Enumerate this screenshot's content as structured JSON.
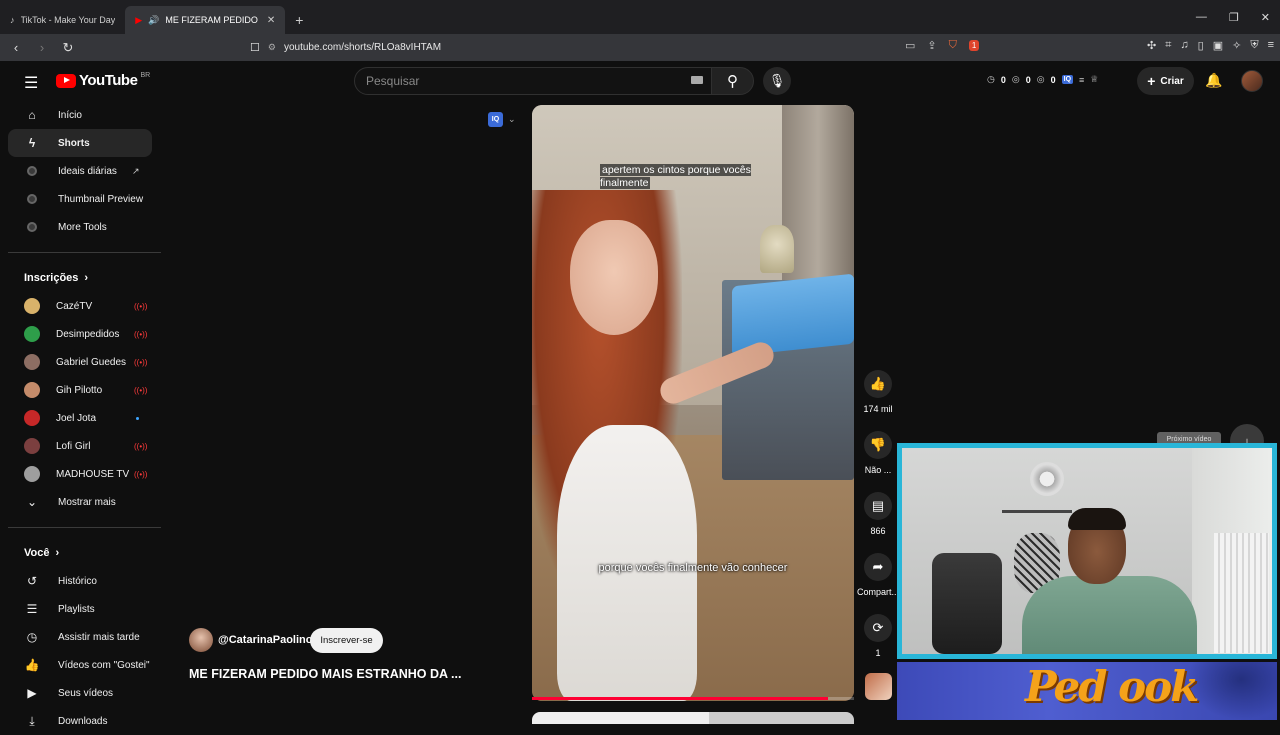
{
  "browser": {
    "tabs": [
      {
        "title": "TikTok - Make Your Day",
        "active": false
      },
      {
        "title": "ME FIZERAM PEDIDO MAIS E",
        "active": true
      }
    ],
    "url": "youtube.com/shorts/RLOa8vIHTAM",
    "brave_badge": "1"
  },
  "header": {
    "logo_text": "YouTube",
    "region": "BR",
    "search_placeholder": "Pesquisar",
    "stats": [
      "0",
      "0",
      "0"
    ],
    "iq_label": "IQ",
    "create_label": "Criar"
  },
  "sidebar": {
    "main": [
      {
        "label": "Início",
        "icon": "home-icon"
      },
      {
        "label": "Shorts",
        "icon": "shorts-icon",
        "active": true
      },
      {
        "label": "Ideais diárias",
        "icon": "extension-icon",
        "external": true
      },
      {
        "label": "Thumbnail Preview",
        "icon": "extension-icon"
      },
      {
        "label": "More Tools",
        "icon": "extension-icon"
      }
    ],
    "subs_title": "Inscrições",
    "subscriptions": [
      {
        "label": "CazéTV",
        "live": true,
        "color": "#d9b26a"
      },
      {
        "label": "Desimpedidos",
        "live": true,
        "color": "#2e9e4a"
      },
      {
        "label": "Gabriel Guedes",
        "live": true,
        "color": "#8d6e63"
      },
      {
        "label": "Gih Pilotto",
        "live": true,
        "color": "#c48b6a"
      },
      {
        "label": "Joel Jota",
        "live": false,
        "color": "#c62828"
      },
      {
        "label": "Lofi Girl",
        "live": true,
        "color": "#7b3f3f"
      },
      {
        "label": "MADHOUSE TV",
        "live": true,
        "color": "#9e9e9e"
      }
    ],
    "show_more": "Mostrar mais",
    "you_title": "Você",
    "you": [
      {
        "label": "Histórico",
        "icon": "history-icon"
      },
      {
        "label": "Playlists",
        "icon": "playlist-icon"
      },
      {
        "label": "Assistir mais tarde",
        "icon": "clock-icon"
      },
      {
        "label": "Vídeos com \"Gostei\"",
        "icon": "thumbs-up-icon"
      },
      {
        "label": "Seus vídeos",
        "icon": "video-icon"
      },
      {
        "label": "Downloads",
        "icon": "download-icon"
      }
    ]
  },
  "short": {
    "caption_top": "apertem os cintos porque vocês finalmente",
    "caption_bottom": "porque vocês finalmente vão conhecer",
    "progress": 0.92,
    "channel": "@CatarinaPaolino",
    "subscribe": "Inscrever-se",
    "title": "ME FIZERAM PEDIDO MAIS ESTRANHO DA ...",
    "actions": {
      "likes": "174 mil",
      "dislike": "Não ...",
      "comments": "866",
      "share": "Compart...",
      "remix": "1"
    }
  },
  "next_tooltip": "Próximo vídeo",
  "overlay": {
    "banner_text": "Ped ook",
    "border_color": "#29b6d8"
  }
}
